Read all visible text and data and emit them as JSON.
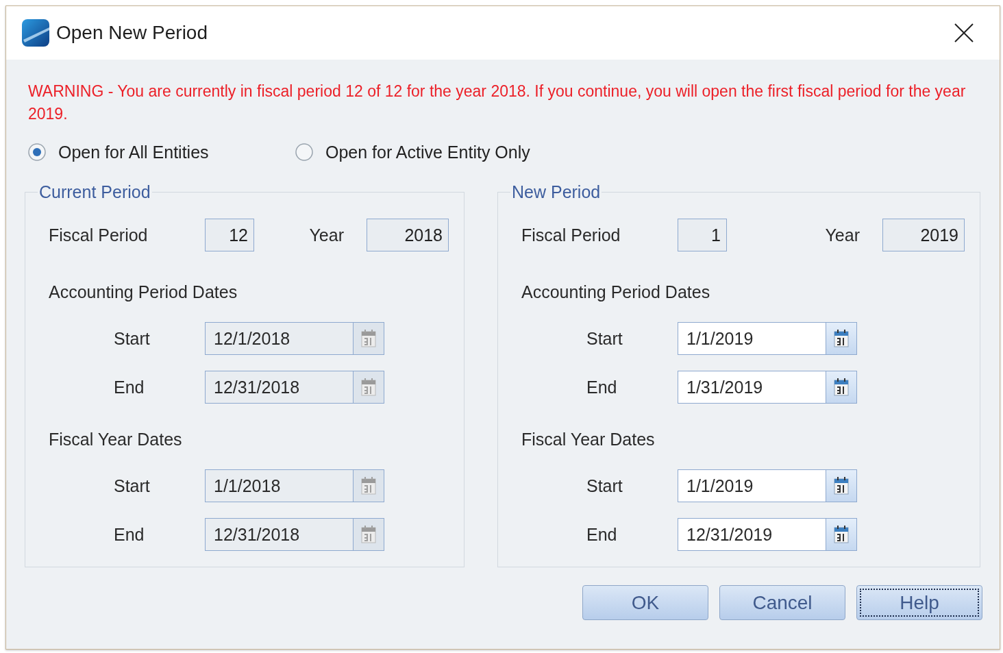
{
  "window": {
    "title": "Open New Period"
  },
  "warning": "WARNING - You are currently in fiscal period 12 of 12 for the year 2018. If you continue, you will open the first fiscal period for the year 2019.",
  "scope_options": [
    {
      "label": "Open for All Entities",
      "selected": true
    },
    {
      "label": "Open for Active Entity Only",
      "selected": false
    }
  ],
  "panels": [
    {
      "title": "Current Period",
      "fiscal_period_label": "Fiscal Period",
      "fiscal_period": "12",
      "year_label": "Year",
      "year": "2018",
      "dates_enabled": false,
      "sections": [
        {
          "title": "Accounting Period Dates",
          "rows": [
            {
              "label": "Start",
              "value": "12/1/2018"
            },
            {
              "label": "End",
              "value": "12/31/2018"
            }
          ]
        },
        {
          "title": "Fiscal Year Dates",
          "rows": [
            {
              "label": "Start",
              "value": "1/1/2018"
            },
            {
              "label": "End",
              "value": "12/31/2018"
            }
          ]
        }
      ]
    },
    {
      "title": "New Period",
      "fiscal_period_label": "Fiscal Period",
      "fiscal_period": "1",
      "year_label": "Year",
      "year": "2019",
      "dates_enabled": true,
      "sections": [
        {
          "title": "Accounting Period Dates",
          "rows": [
            {
              "label": "Start",
              "value": "1/1/2019"
            },
            {
              "label": "End",
              "value": "1/31/2019"
            }
          ]
        },
        {
          "title": "Fiscal Year Dates",
          "rows": [
            {
              "label": "Start",
              "value": "1/1/2019"
            },
            {
              "label": "End",
              "value": "12/31/2019"
            }
          ]
        }
      ]
    }
  ],
  "buttons": [
    {
      "label": "OK",
      "focused": false
    },
    {
      "label": "Cancel",
      "focused": false
    },
    {
      "label": "Help",
      "focused": true
    }
  ]
}
